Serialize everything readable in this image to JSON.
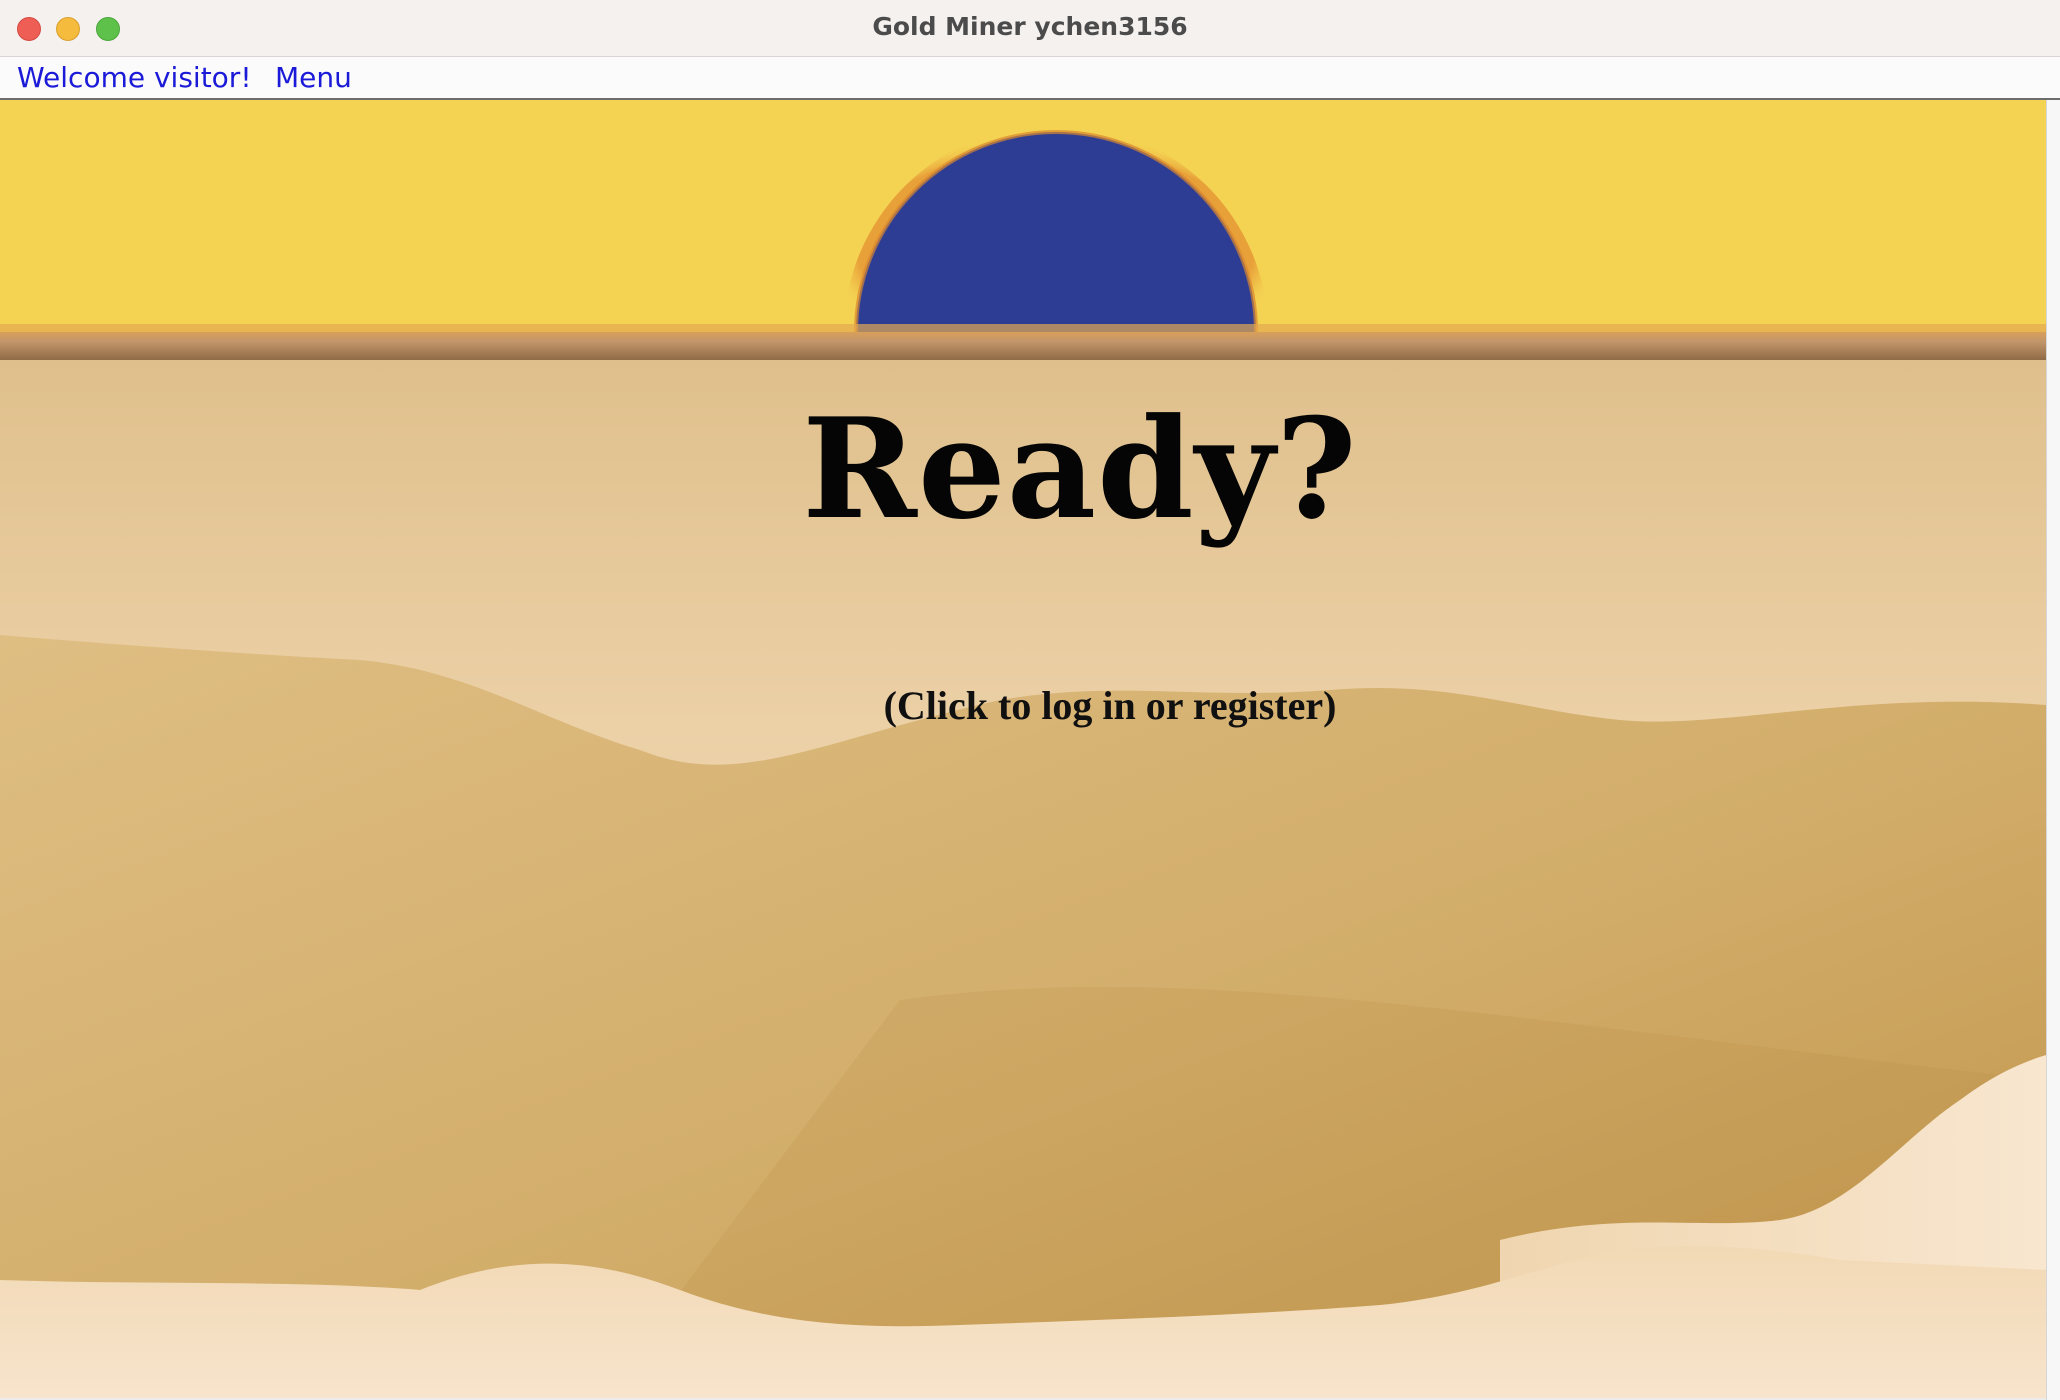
{
  "window": {
    "title": "Gold Miner ychen3156"
  },
  "menubar": {
    "items": [
      {
        "label": "Welcome visitor!"
      },
      {
        "label": "Menu"
      }
    ]
  },
  "scene": {
    "heading": "Ready?",
    "subtitle": "(Click to log in or register)",
    "colors": {
      "sky": "#f4d352",
      "sun": "#2e3d94",
      "sun_glow": "#e79a36",
      "ground_band": "#c1956a",
      "sand_light": "#f5dfbf",
      "sand_mid": "#dcba7e",
      "sand_dark": "#c59a4d"
    }
  }
}
